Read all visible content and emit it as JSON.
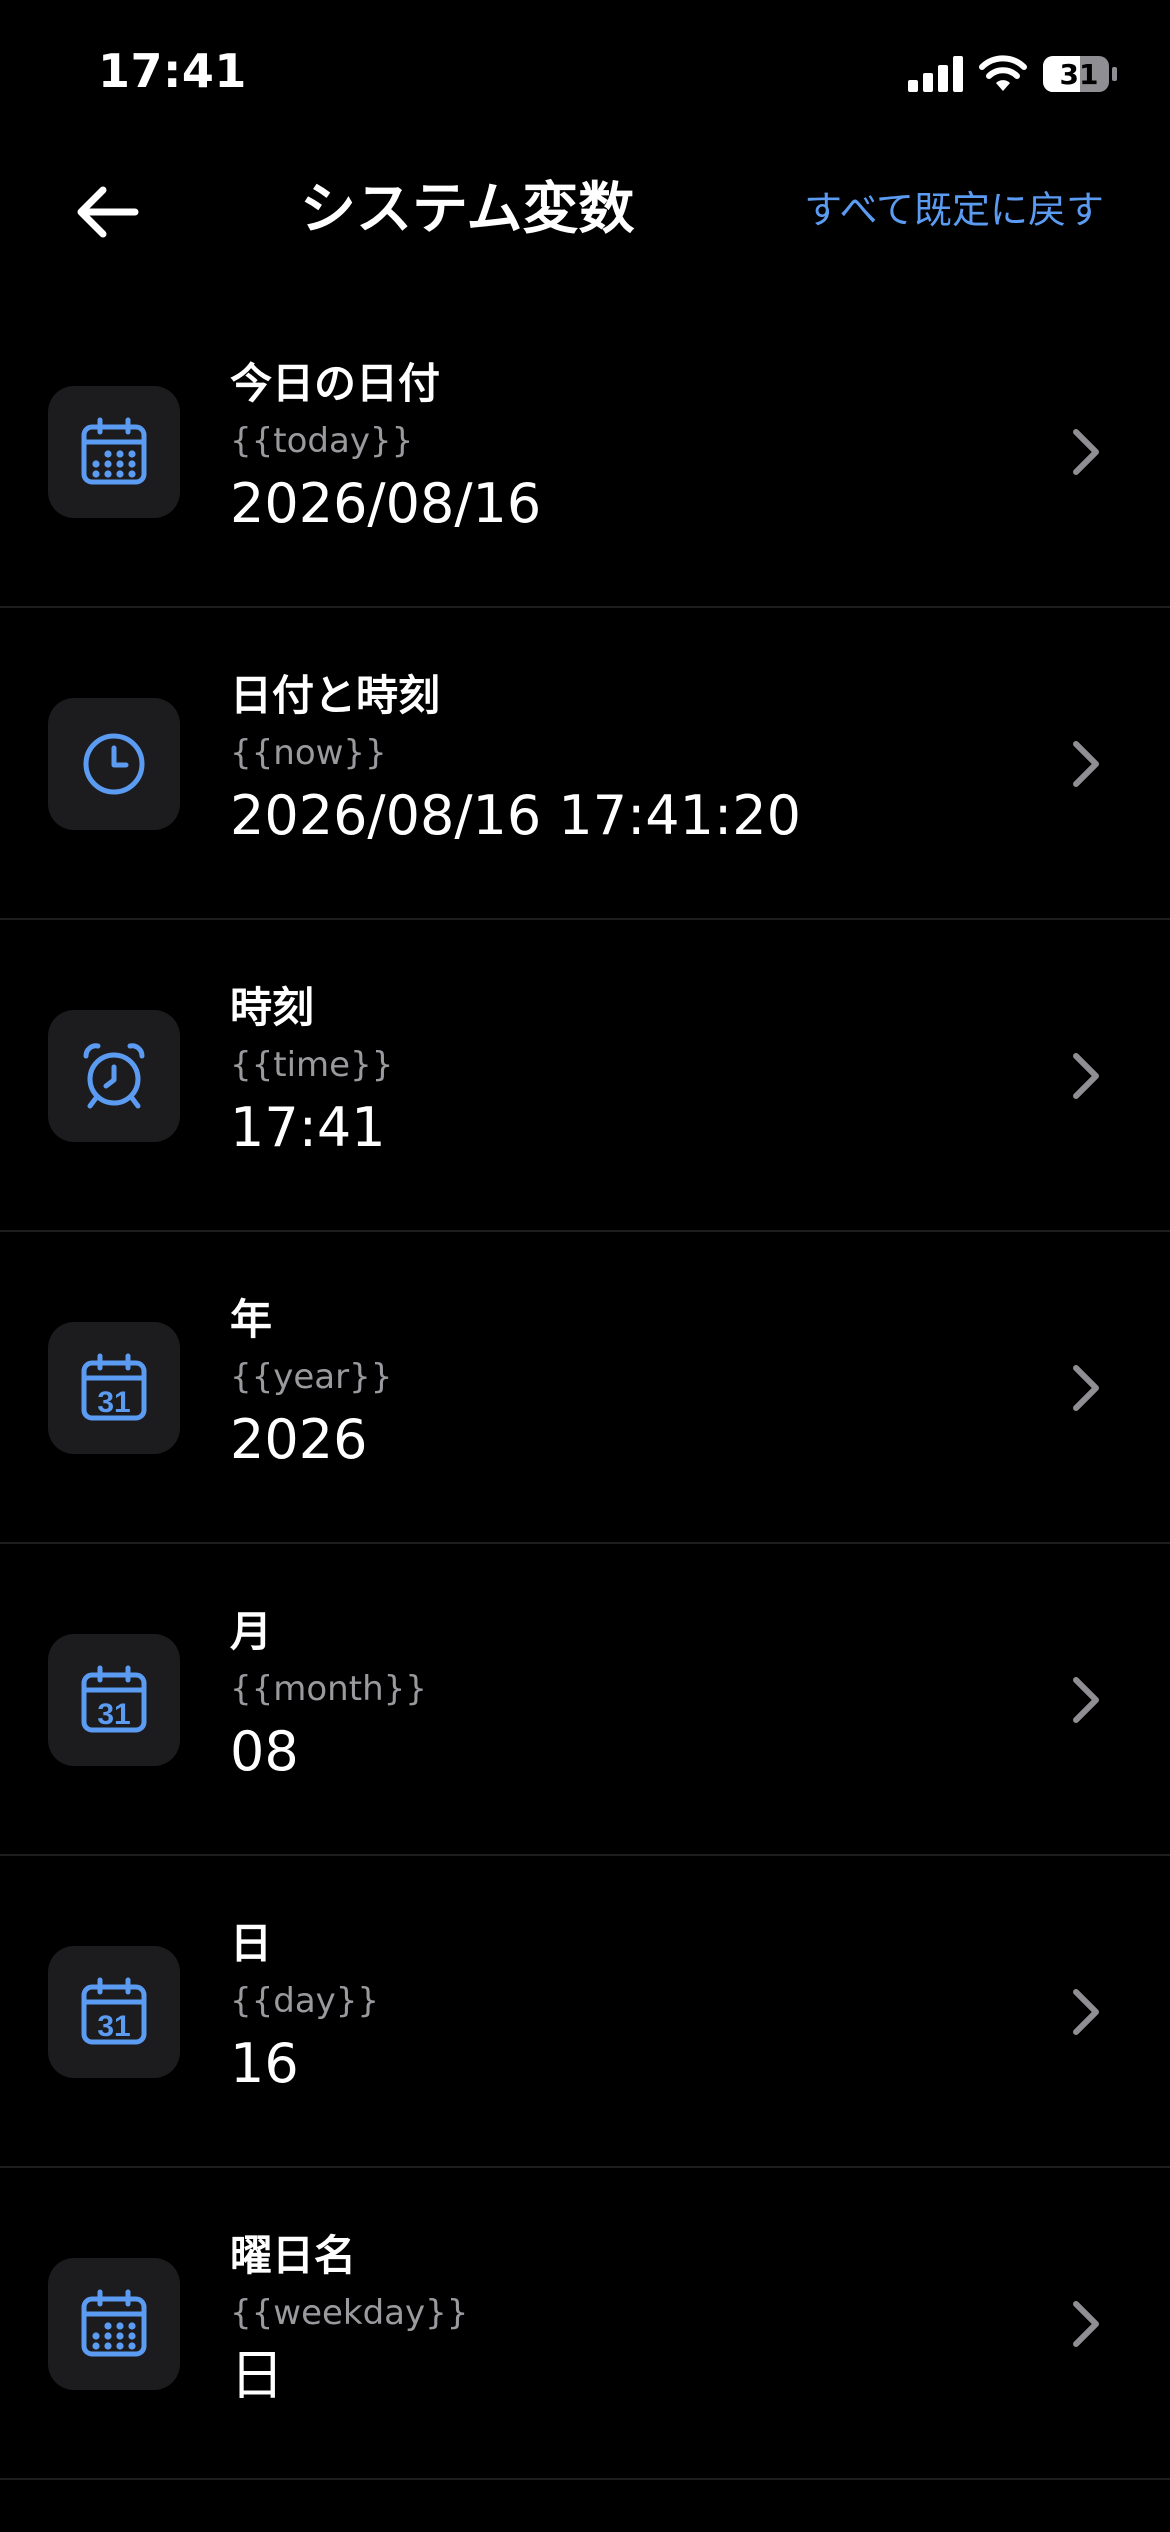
{
  "status_bar": {
    "time": "17:41",
    "battery_level": "31",
    "icons": [
      "signal-icon",
      "wifi-icon",
      "battery-icon"
    ]
  },
  "nav": {
    "title": "システム変数",
    "reset_all_label": "すべて既定に戻す",
    "back_icon": "arrow-left-icon"
  },
  "colors": {
    "accent": "#5b9cf2",
    "background": "#000000",
    "tile": "#1c1c1e",
    "token_text": "#9a9a9e"
  },
  "variables": [
    {
      "label": "今日の日付",
      "token": "{{today}}",
      "value": "2026/08/16",
      "icon": "calendar-grid-icon"
    },
    {
      "label": "日付と時刻",
      "token": "{{now}}",
      "value": "2026/08/16 17:41:20",
      "icon": "clock-icon"
    },
    {
      "label": "時刻",
      "token": "{{time}}",
      "value": "17:41",
      "icon": "alarm-clock-icon"
    },
    {
      "label": "年",
      "token": "{{year}}",
      "value": "2026",
      "icon": "calendar-31-icon"
    },
    {
      "label": "月",
      "token": "{{month}}",
      "value": "08",
      "icon": "calendar-31-icon"
    },
    {
      "label": "日",
      "token": "{{day}}",
      "value": "16",
      "icon": "calendar-31-icon"
    },
    {
      "label": "曜日名",
      "token": "{{weekday}}",
      "value": "日",
      "icon": "calendar-grid-icon"
    }
  ]
}
